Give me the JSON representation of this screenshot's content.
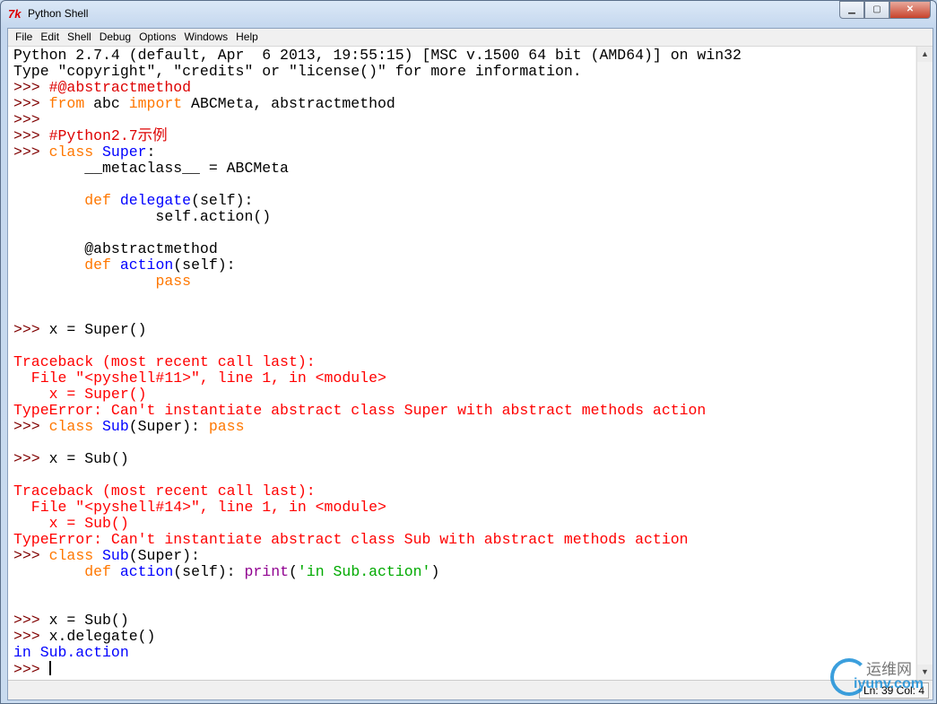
{
  "window": {
    "title": "Python Shell",
    "icon": "tk-feather-icon",
    "minimize": "minimize-icon",
    "maximize": "maximize-icon",
    "close": "close-icon"
  },
  "menu": [
    "File",
    "Edit",
    "Shell",
    "Debug",
    "Options",
    "Windows",
    "Help"
  ],
  "status": "Ln: 39 Col: 4",
  "watermark": {
    "text1": "运维网",
    "text2": "iyunv.com"
  },
  "colors": {
    "prompt": "#800000",
    "comment": "#dd0000",
    "keyword": "#ff7700",
    "definition": "#0000ff",
    "string": "#00aa00",
    "builtin": "#900090",
    "stdout": "#0000ff",
    "stderr": "#ff0000"
  },
  "lines": [
    [
      [
        "n",
        "Python 2.7.4 (default, Apr  6 2013, 19:55:15) [MSC v.1500 64 bit (AMD64)] on win32"
      ]
    ],
    [
      [
        "n",
        "Type \"copyright\", \"credits\" or \"license()\" for more information."
      ]
    ],
    [
      [
        "prompt",
        ">>> "
      ],
      [
        "comment",
        "#@abstractmethod"
      ]
    ],
    [
      [
        "prompt",
        ">>> "
      ],
      [
        "kw",
        "from"
      ],
      [
        "n",
        " abc "
      ],
      [
        "kw",
        "import"
      ],
      [
        "n",
        " ABCMeta, abstractmethod"
      ]
    ],
    [
      [
        "prompt",
        ">>>"
      ]
    ],
    [
      [
        "prompt",
        ">>> "
      ],
      [
        "comment",
        "#Python2.7示例"
      ]
    ],
    [
      [
        "prompt",
        ">>> "
      ],
      [
        "kw",
        "class"
      ],
      [
        "n",
        " "
      ],
      [
        "def",
        "Super"
      ],
      [
        "n",
        ":"
      ]
    ],
    [
      [
        "n",
        "        __metaclass__ = ABCMeta"
      ]
    ],
    [],
    [
      [
        "n",
        "        "
      ],
      [
        "kw",
        "def"
      ],
      [
        "n",
        " "
      ],
      [
        "def",
        "delegate"
      ],
      [
        "n",
        "(self):"
      ]
    ],
    [
      [
        "n",
        "                self.action()"
      ]
    ],
    [],
    [
      [
        "n",
        "        @abstractmethod"
      ]
    ],
    [
      [
        "n",
        "        "
      ],
      [
        "kw",
        "def"
      ],
      [
        "n",
        " "
      ],
      [
        "def",
        "action"
      ],
      [
        "n",
        "(self):"
      ]
    ],
    [
      [
        "n",
        "                "
      ],
      [
        "kw",
        "pass"
      ]
    ],
    [],
    [],
    [
      [
        "prompt",
        ">>> "
      ],
      [
        "n",
        "x = Super()"
      ]
    ],
    [],
    [
      [
        "err",
        "Traceback (most recent call last):"
      ]
    ],
    [
      [
        "err",
        "  File \"<pyshell#11>\", line 1, in <module>"
      ]
    ],
    [
      [
        "err",
        "    x = Super()"
      ]
    ],
    [
      [
        "err",
        "TypeError: Can't instantiate abstract class Super with abstract methods action"
      ]
    ],
    [
      [
        "prompt",
        ">>> "
      ],
      [
        "kw",
        "class"
      ],
      [
        "n",
        " "
      ],
      [
        "def",
        "Sub"
      ],
      [
        "n",
        "(Super): "
      ],
      [
        "kw",
        "pass"
      ]
    ],
    [],
    [
      [
        "prompt",
        ">>> "
      ],
      [
        "n",
        "x = Sub()"
      ]
    ],
    [],
    [
      [
        "err",
        "Traceback (most recent call last):"
      ]
    ],
    [
      [
        "err",
        "  File \"<pyshell#14>\", line 1, in <module>"
      ]
    ],
    [
      [
        "err",
        "    x = Sub()"
      ]
    ],
    [
      [
        "err",
        "TypeError: Can't instantiate abstract class Sub with abstract methods action"
      ]
    ],
    [
      [
        "prompt",
        ">>> "
      ],
      [
        "kw",
        "class"
      ],
      [
        "n",
        " "
      ],
      [
        "def",
        "Sub"
      ],
      [
        "n",
        "(Super):"
      ]
    ],
    [
      [
        "n",
        "        "
      ],
      [
        "kw",
        "def"
      ],
      [
        "n",
        " "
      ],
      [
        "def",
        "action"
      ],
      [
        "n",
        "(self): "
      ],
      [
        "bi",
        "print"
      ],
      [
        "n",
        "("
      ],
      [
        "str",
        "'in Sub.action'"
      ],
      [
        "n",
        ")"
      ]
    ],
    [],
    [],
    [
      [
        "prompt",
        ">>> "
      ],
      [
        "n",
        "x = Sub()"
      ]
    ],
    [
      [
        "prompt",
        ">>> "
      ],
      [
        "n",
        "x.delegate()"
      ]
    ],
    [
      [
        "out",
        "in Sub.action"
      ]
    ],
    [
      [
        "prompt",
        ">>> "
      ]
    ]
  ]
}
